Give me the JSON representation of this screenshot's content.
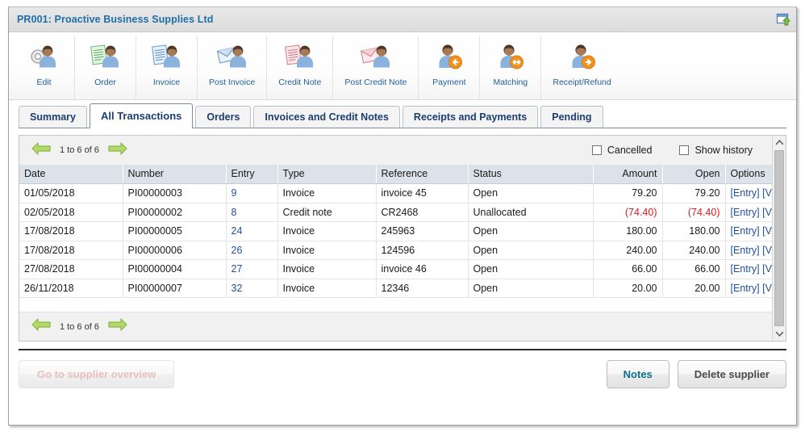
{
  "titlebar": {
    "title": "PR001: Proactive Business Supplies Ltd",
    "popout_icon": "popout-window-icon"
  },
  "toolbar": {
    "items": [
      {
        "label": "Edit",
        "icon": "user-gear-icon"
      },
      {
        "label": "Order",
        "icon": "user-order-document-icon"
      },
      {
        "label": "Invoice",
        "icon": "user-invoice-document-icon"
      },
      {
        "label": "Post Invoice",
        "icon": "user-post-invoice-envelope-icon"
      },
      {
        "label": "Credit Note",
        "icon": "user-credit-note-document-icon"
      },
      {
        "label": "Post Credit Note",
        "icon": "user-post-credit-note-envelope-icon"
      },
      {
        "label": "Payment",
        "icon": "user-payment-arrow-left-icon"
      },
      {
        "label": "Matching",
        "icon": "user-matching-arrows-icon"
      },
      {
        "label": "Receipt/Refund",
        "icon": "user-receipt-arrow-right-icon"
      }
    ]
  },
  "tabs": [
    {
      "label": "Summary",
      "active": false
    },
    {
      "label": "All Transactions",
      "active": true
    },
    {
      "label": "Orders",
      "active": false
    },
    {
      "label": "Invoices and Credit Notes",
      "active": false
    },
    {
      "label": "Receipts and Payments",
      "active": false
    },
    {
      "label": "Pending",
      "active": false
    }
  ],
  "pager": {
    "range_text": "1 to 6 of 6",
    "prev_icon": "arrow-left-icon",
    "next_icon": "arrow-right-icon"
  },
  "filters": {
    "cancelled": {
      "label": "Cancelled",
      "checked": false
    },
    "show_history": {
      "label": "Show history",
      "checked": false
    }
  },
  "table": {
    "columns": [
      "Date",
      "Number",
      "Entry",
      "Type",
      "Reference",
      "Status",
      "Amount",
      "Open",
      "Options"
    ],
    "rows": [
      {
        "date": "01/05/2018",
        "number": "PI00000003",
        "entry": "9",
        "type": "Invoice",
        "reference": "invoice 45",
        "status": "Open",
        "amount": "79.20",
        "open": "79.20",
        "negative": false,
        "options": [
          "[Entry]",
          "[View]"
        ]
      },
      {
        "date": "02/05/2018",
        "number": "PI00000002",
        "entry": "8",
        "type": "Credit note",
        "reference": "CR2468",
        "status": "Unallocated",
        "amount": "(74.40)",
        "open": "(74.40)",
        "negative": true,
        "options": [
          "[Entry]",
          "[View]"
        ]
      },
      {
        "date": "17/08/2018",
        "number": "PI00000005",
        "entry": "24",
        "type": "Invoice",
        "reference": "245963",
        "status": "Open",
        "amount": "180.00",
        "open": "180.00",
        "negative": false,
        "options": [
          "[Entry]",
          "[View]"
        ]
      },
      {
        "date": "17/08/2018",
        "number": "PI00000006",
        "entry": "26",
        "type": "Invoice",
        "reference": "124596",
        "status": "Open",
        "amount": "240.00",
        "open": "240.00",
        "negative": false,
        "options": [
          "[Entry]",
          "[View]"
        ]
      },
      {
        "date": "27/08/2018",
        "number": "PI00000004",
        "entry": "27",
        "type": "Invoice",
        "reference": "invoice 46",
        "status": "Open",
        "amount": "66.00",
        "open": "66.00",
        "negative": false,
        "options": [
          "[Entry]",
          "[View]"
        ]
      },
      {
        "date": "26/11/2018",
        "number": "PI00000007",
        "entry": "32",
        "type": "Invoice",
        "reference": "12346",
        "status": "Open",
        "amount": "20.00",
        "open": "20.00",
        "negative": false,
        "options": [
          "[Entry]",
          "[View]"
        ]
      }
    ]
  },
  "scrollbar": {
    "up_icon": "chevron-up-icon",
    "down_icon": "chevron-down-icon"
  },
  "footer": {
    "supplier_overview_label": "Go to supplier overview",
    "notes_label": "Notes",
    "delete_label": "Delete supplier"
  },
  "colors": {
    "title": "#1f6ea8",
    "tab_text": "#1b3d72",
    "link": "#21509b",
    "negative": "#d81d1d",
    "notes_text": "#0b6f8c",
    "disabled_text": "#e0a6a6",
    "header_bg": "#dbe2ea"
  }
}
